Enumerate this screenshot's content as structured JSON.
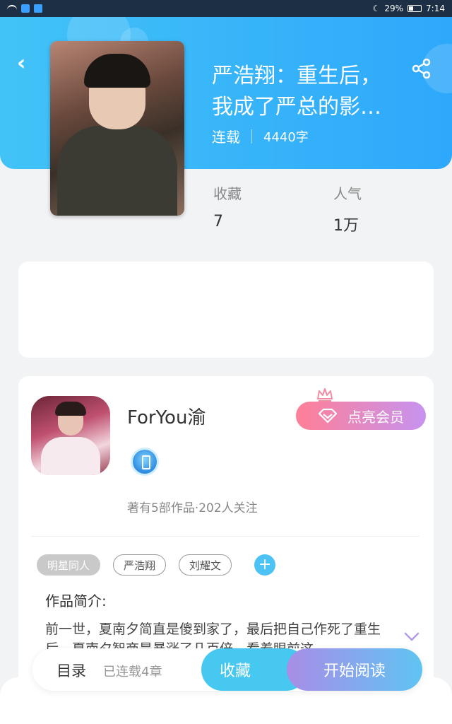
{
  "status_bar": {
    "battery": "29%",
    "time": "7:14"
  },
  "book": {
    "title_line1": "严浩翔：重生后，",
    "title_line2": "我成了严总的影…",
    "status": "连载",
    "word_count": "4440字"
  },
  "stats": [
    {
      "label": "收藏",
      "value": "7"
    },
    {
      "label": "人气",
      "value": "1万"
    }
  ],
  "author": {
    "name": "ForYou渝",
    "meta": "著有5部作品·202人关注",
    "vip_label": "点亮会员"
  },
  "tags": [
    "明星同人",
    "严浩翔",
    "刘耀文"
  ],
  "intro": {
    "title": "作品简介:",
    "text": "前一世，夏南夕简直是傻到家了，最后把自己作死了重生后，夏南夕智商是暴涨了几百倍，看着眼前这"
  },
  "bottom": {
    "toc_label": "目录",
    "chapters": "已连载4章",
    "fav_label": "收藏",
    "read_label": "开始阅读"
  },
  "colors": {
    "header_start": "#42c3f7",
    "header_end": "#2ea8fb",
    "vip_start": "#ff7f96",
    "vip_end": "#c693f0",
    "fav_btn": "#46c8f0"
  }
}
